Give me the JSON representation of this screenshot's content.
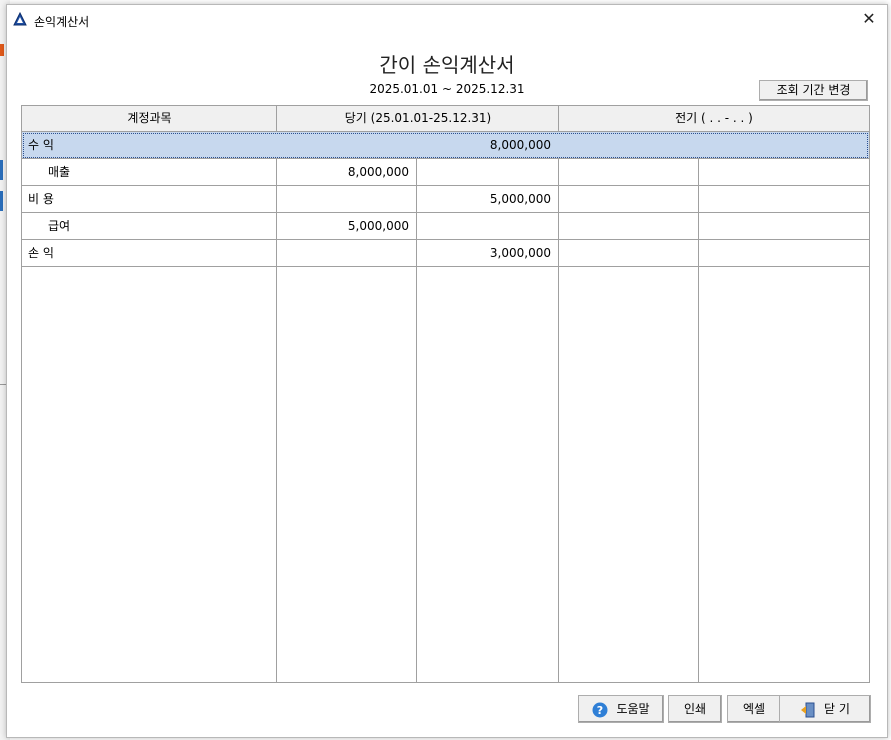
{
  "window": {
    "title": "손익계산서",
    "close_glyph": "✕"
  },
  "report": {
    "title": "간이 손익계산서",
    "period": "2025.01.01 ~ 2025.12.31",
    "change_period_label": "조회 기간 변경"
  },
  "table": {
    "headers": {
      "account": "계정과목",
      "current": "당기 (25.01.01-25.12.31)",
      "previous": "전기 (  .  .  -  .  .  )"
    },
    "rows": [
      {
        "account": "수 익",
        "indent": false,
        "cur_detail": "",
        "cur_total": "8,000,000",
        "selected": true
      },
      {
        "account": "매출",
        "indent": true,
        "cur_detail": "8,000,000",
        "cur_total": "",
        "selected": false
      },
      {
        "account": "비 용",
        "indent": false,
        "cur_detail": "",
        "cur_total": "5,000,000",
        "selected": false
      },
      {
        "account": "급여",
        "indent": true,
        "cur_detail": "5,000,000",
        "cur_total": "",
        "selected": false
      },
      {
        "account": "손 익",
        "indent": false,
        "cur_detail": "",
        "cur_total": "3,000,000",
        "selected": false
      }
    ]
  },
  "footer": {
    "help_label": "도움말",
    "print_label": "인쇄",
    "excel_label": "엑셀",
    "close_label": "닫 기"
  },
  "colors": {
    "selected_row": "#c7d8ee",
    "header_bg": "#f0f0f0",
    "grid_line": "#a0a0a0",
    "help_icon": "#2f7fd6"
  },
  "icons": {
    "app": "triangle-logo-icon",
    "help": "question-icon",
    "close": "exit-door-icon"
  }
}
